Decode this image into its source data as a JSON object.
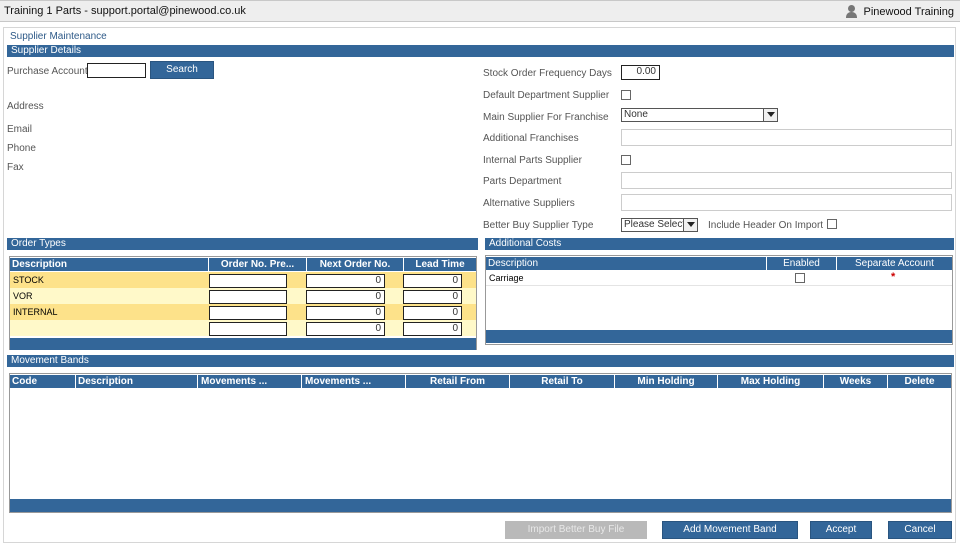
{
  "window": {
    "title": "Training 1 Parts - support.portal@pinewood.co.uk",
    "user": "Pinewood Training"
  },
  "page_title": "Supplier Maintenance",
  "supplier_details": {
    "header": "Supplier Details",
    "purchase_account_label": "Purchase Account",
    "purchase_account_value": "",
    "search_label": "Search",
    "address_label": "Address",
    "email_label": "Email",
    "phone_label": "Phone",
    "fax_label": "Fax",
    "stock_order_frequency_label": "Stock Order Frequency Days",
    "stock_order_frequency_value": "0.00",
    "default_department_label": "Default Department Supplier",
    "main_supplier_label": "Main Supplier For Franchise",
    "main_supplier_value": "None",
    "additional_franchises_label": "Additional Franchises",
    "internal_parts_label": "Internal Parts Supplier",
    "parts_department_label": "Parts Department",
    "alternative_suppliers_label": "Alternative Suppliers",
    "better_buy_label": "Better Buy Supplier Type",
    "better_buy_value": "Please Select...",
    "include_header_label": "Include Header On Import"
  },
  "order_types": {
    "header": "Order Types",
    "columns": [
      "Description",
      "Order No. Pre...",
      "Next Order No.",
      "Lead Time"
    ],
    "rows": [
      {
        "description": "STOCK",
        "prefix": "",
        "next": "0",
        "lead": "0"
      },
      {
        "description": "VOR",
        "prefix": "",
        "next": "0",
        "lead": "0"
      },
      {
        "description": "INTERNAL",
        "prefix": "",
        "next": "0",
        "lead": "0"
      },
      {
        "description": "",
        "prefix": "",
        "next": "0",
        "lead": "0"
      }
    ]
  },
  "additional_costs": {
    "header": "Additional Costs",
    "columns": [
      "Description",
      "Enabled",
      "Separate Account"
    ],
    "rows": [
      {
        "description": "Carriage",
        "separate_mark": "*"
      }
    ]
  },
  "movement_bands": {
    "header": "Movement Bands",
    "columns": [
      "Code",
      "Description",
      "Movements ...",
      "Movements ...",
      "Retail From",
      "Retail To",
      "Min Holding",
      "Max Holding",
      "Weeks",
      "Delete"
    ]
  },
  "buttons": {
    "import_better_buy": "Import Better Buy File",
    "add_movement_band": "Add Movement Band",
    "accept": "Accept",
    "cancel": "Cancel"
  },
  "colors": {
    "header_blue": "#336699",
    "row_odd": "#fde28a",
    "row_even": "#fff9c9",
    "required_mark": "#cc0000"
  }
}
